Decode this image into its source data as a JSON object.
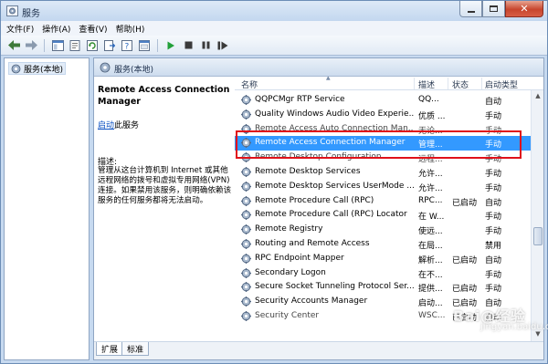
{
  "window": {
    "title": "服务",
    "close_glyph": "✕"
  },
  "menu": [
    "文件(F)",
    "操作(A)",
    "查看(V)",
    "帮助(H)"
  ],
  "toolbar_icons": [
    "back-arrow-icon",
    "forward-arrow-icon",
    "console-tree-icon",
    "properties-icon",
    "refresh-icon",
    "export-list-icon",
    "help-icon",
    "console-icon",
    "start-service-icon",
    "stop-service-icon",
    "pause-service-icon",
    "restart-service-icon"
  ],
  "tree": {
    "root_label": "服务(本地)"
  },
  "right_header": {
    "title": "服务(本地)"
  },
  "description": {
    "service_name": "Remote Access Connection Manager",
    "start_link": "启动",
    "start_suffix": "此服务",
    "label": "描述:",
    "text": "管理从这台计算机到 Internet 或其他远程网络的拨号和虚拟专用网络(VPN)连接。如果禁用该服务，则明确依赖该服务的任何服务都将无法启动。"
  },
  "columns": {
    "name": "名称",
    "desc": "描述",
    "status": "状态",
    "startup": "启动类型"
  },
  "services": [
    {
      "name": "QQPCMgr RTP Service",
      "desc": "QQ...",
      "status": "",
      "startup": "自动"
    },
    {
      "name": "Quality Windows Audio Video Experie...",
      "desc": "优质 ...",
      "status": "",
      "startup": "手动"
    },
    {
      "name": "Remote Access Auto Connection Man...",
      "desc": "无论...",
      "status": "",
      "startup": "手动"
    },
    {
      "name": "Remote Access Connection Manager",
      "desc": "管理...",
      "status": "",
      "startup": "手动"
    },
    {
      "name": "Remote Desktop Configuration",
      "desc": "远程...",
      "status": "",
      "startup": "手动"
    },
    {
      "name": "Remote Desktop Services",
      "desc": "允许...",
      "status": "",
      "startup": "手动"
    },
    {
      "name": "Remote Desktop Services UserMode ...",
      "desc": "允许...",
      "status": "",
      "startup": "手动"
    },
    {
      "name": "Remote Procedure Call (RPC)",
      "desc": "RPC...",
      "status": "已启动",
      "startup": "自动"
    },
    {
      "name": "Remote Procedure Call (RPC) Locator",
      "desc": "在 W...",
      "status": "",
      "startup": "手动"
    },
    {
      "name": "Remote Registry",
      "desc": "使远...",
      "status": "",
      "startup": "手动"
    },
    {
      "name": "Routing and Remote Access",
      "desc": "在局...",
      "status": "",
      "startup": "禁用"
    },
    {
      "name": "RPC Endpoint Mapper",
      "desc": "解析...",
      "status": "已启动",
      "startup": "自动"
    },
    {
      "name": "Secondary Logon",
      "desc": "在不...",
      "status": "",
      "startup": "手动"
    },
    {
      "name": "Secure Socket Tunneling Protocol Ser...",
      "desc": "提供...",
      "status": "已启动",
      "startup": "手动"
    },
    {
      "name": "Security Accounts Manager",
      "desc": "启动...",
      "status": "已启动",
      "startup": "自动"
    },
    {
      "name": "Security Center",
      "desc": "WSC...",
      "status": "已启动",
      "startup": "自动"
    }
  ],
  "selected_index": 3,
  "tabs": [
    "扩展",
    "标准"
  ],
  "watermark": {
    "main": "Bai@经验",
    "sub": "jingyan.baidu.com"
  },
  "colors": {
    "selection": "#3399ff",
    "highlight_box": "#e0111a",
    "link": "#0b50c2"
  }
}
